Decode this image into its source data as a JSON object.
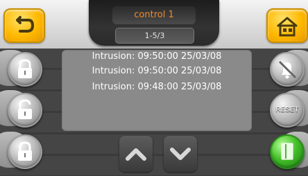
{
  "header": {
    "title": "control 1",
    "page_indicator": "1-5/3"
  },
  "nav": {
    "back_icon": "back-arrow-icon",
    "home_icon": "home-icon"
  },
  "left_buttons": [
    {
      "icon": "padlock-closed-icon"
    },
    {
      "icon": "padlock-open-icon"
    },
    {
      "icon": "padlock-partial-icon"
    }
  ],
  "right_buttons": {
    "mute_icon": "bell-muted-icon",
    "reset_label": "RESET",
    "list_icon": "document-icon"
  },
  "log": {
    "entries": [
      "Intrusion: 09:50:00 25/03/08",
      "Intrusion: 09:50:00 25/03/08",
      "Intrusion: 09:48:00 25/03/08"
    ]
  },
  "scroll": {
    "up_icon": "chevron-up-icon",
    "down_icon": "chevron-down-icon"
  },
  "colors": {
    "accent_yellow": "#ffb800",
    "title_orange": "#f08c2a",
    "ok_green": "#45c12a"
  }
}
